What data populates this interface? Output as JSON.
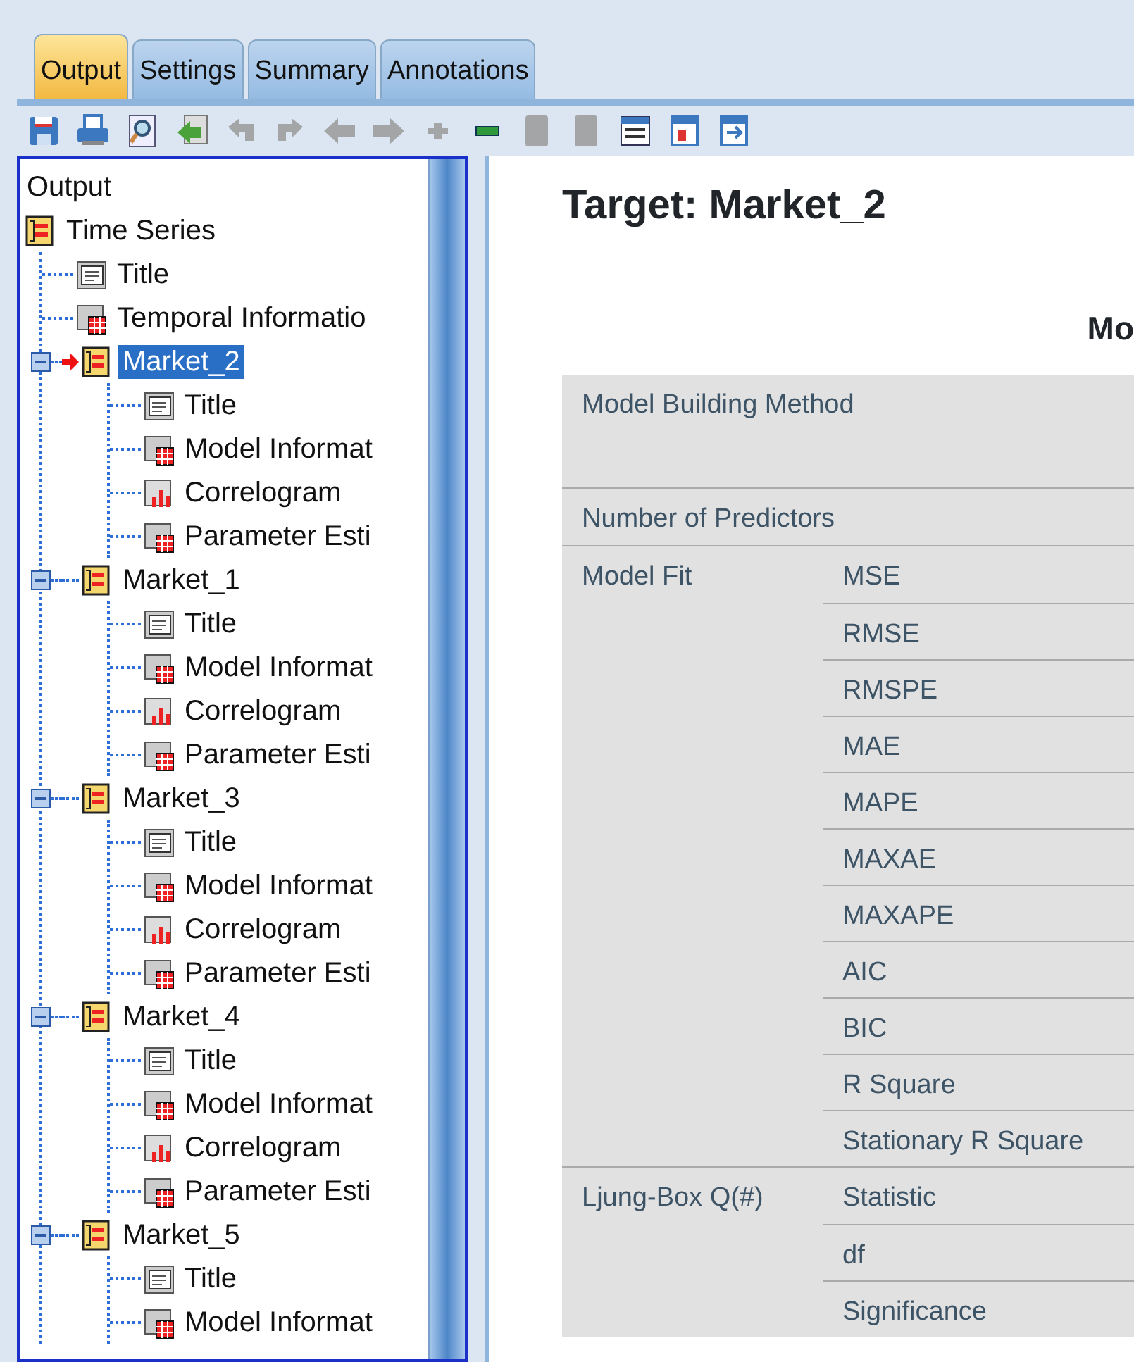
{
  "tabs": [
    {
      "label": "Output",
      "selected": true
    },
    {
      "label": "Settings",
      "selected": false
    },
    {
      "label": "Summary",
      "selected": false
    },
    {
      "label": "Annotations",
      "selected": false
    }
  ],
  "toolbar": [
    {
      "kind": "save",
      "disabled": false
    },
    {
      "kind": "print",
      "disabled": false
    },
    {
      "kind": "preview",
      "disabled": false
    },
    {
      "kind": "export",
      "disabled": false
    },
    {
      "kind": "undo",
      "disabled": true
    },
    {
      "kind": "redo",
      "disabled": true
    },
    {
      "kind": "back",
      "disabled": true
    },
    {
      "kind": "forward",
      "disabled": true
    },
    {
      "kind": "plus",
      "disabled": true
    },
    {
      "kind": "minus",
      "disabled": false
    },
    {
      "kind": "page",
      "disabled": true
    },
    {
      "kind": "page",
      "disabled": true
    },
    {
      "kind": "window",
      "disabled": false
    },
    {
      "kind": "copy",
      "disabled": false
    },
    {
      "kind": "paste",
      "disabled": false
    }
  ],
  "tree": {
    "root": "Output",
    "items": [
      {
        "label": "Time Series",
        "kind": "folder",
        "selected": false,
        "current": false,
        "children": [
          {
            "label": "Title",
            "kind": "text",
            "selected": false
          },
          {
            "label": "Temporal Informatio",
            "kind": "table",
            "selected": false
          },
          {
            "label": "Market_2",
            "kind": "folder",
            "selected": true,
            "current": true,
            "expanded": true,
            "children": [
              {
                "label": "Title",
                "kind": "text",
                "selected": false
              },
              {
                "label": "Model Informat",
                "kind": "table",
                "selected": false
              },
              {
                "label": "Correlogram",
                "kind": "chart",
                "selected": false
              },
              {
                "label": "Parameter Esti",
                "kind": "table",
                "selected": false
              }
            ]
          },
          {
            "label": "Market_1",
            "kind": "folder",
            "selected": false,
            "current": false,
            "expanded": true,
            "children": [
              {
                "label": "Title",
                "kind": "text",
                "selected": false
              },
              {
                "label": "Model Informat",
                "kind": "table",
                "selected": false
              },
              {
                "label": "Correlogram",
                "kind": "chart",
                "selected": false
              },
              {
                "label": "Parameter Esti",
                "kind": "table",
                "selected": false
              }
            ]
          },
          {
            "label": "Market_3",
            "kind": "folder",
            "selected": false,
            "current": false,
            "expanded": true,
            "children": [
              {
                "label": "Title",
                "kind": "text",
                "selected": false
              },
              {
                "label": "Model Informat",
                "kind": "table",
                "selected": false
              },
              {
                "label": "Correlogram",
                "kind": "chart",
                "selected": false
              },
              {
                "label": "Parameter Esti",
                "kind": "table",
                "selected": false
              }
            ]
          },
          {
            "label": "Market_4",
            "kind": "folder",
            "selected": false,
            "current": false,
            "expanded": true,
            "children": [
              {
                "label": "Title",
                "kind": "text",
                "selected": false
              },
              {
                "label": "Model Informat",
                "kind": "table",
                "selected": false
              },
              {
                "label": "Correlogram",
                "kind": "chart",
                "selected": false
              },
              {
                "label": "Parameter Esti",
                "kind": "table",
                "selected": false
              }
            ]
          },
          {
            "label": "Market_5",
            "kind": "folder",
            "selected": false,
            "current": false,
            "expanded": true,
            "children": [
              {
                "label": "Title",
                "kind": "text",
                "selected": false
              },
              {
                "label": "Model Informat",
                "kind": "table",
                "selected": false
              }
            ]
          }
        ]
      }
    ]
  },
  "report": {
    "title": "Target: Market_2",
    "table_title": "Mo",
    "groups": [
      {
        "label": "Model Building Method",
        "tall": true
      },
      {
        "label": "Number of Predictors",
        "tall": false
      },
      {
        "label": "Model Fit",
        "tall": false,
        "rows": [
          "MSE",
          "RMSE",
          "RMSPE",
          "MAE",
          "MAPE",
          "MAXAE",
          "MAXAPE",
          "AIC",
          "BIC",
          "R Square",
          "Stationary R Square"
        ]
      },
      {
        "label": "Ljung-Box Q(#)",
        "tall": false,
        "rows": [
          "Statistic",
          "df",
          "Significance"
        ]
      }
    ]
  }
}
